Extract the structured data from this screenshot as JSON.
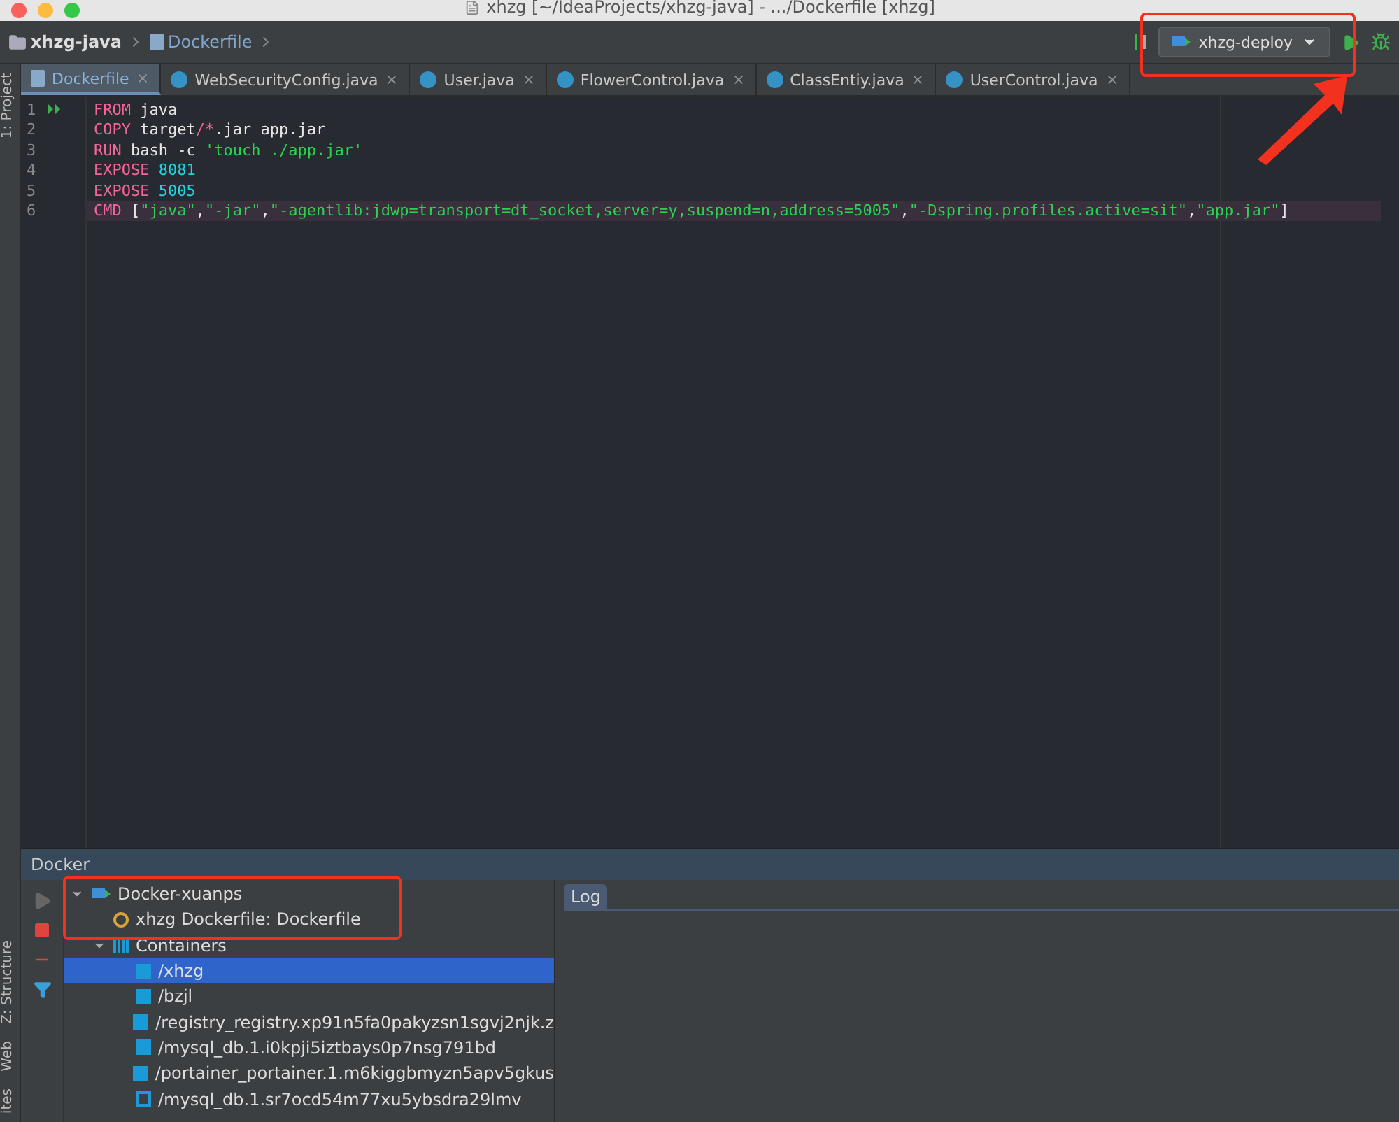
{
  "window": {
    "title": "xhzg [~/IdeaProjects/xhzg-java] - .../Dockerfile [xhzg]"
  },
  "breadcrumbs": [
    {
      "label": "xhzg-java",
      "kind": "project"
    },
    {
      "label": "Dockerfile",
      "kind": "file"
    }
  ],
  "run_config": {
    "label": "xhzg-deploy"
  },
  "side_tabs": [
    {
      "label": "1: Project",
      "kind": "top"
    },
    {
      "label": "Z: Structure",
      "kind": "bottom"
    },
    {
      "label": "Web",
      "kind": "bottom"
    },
    {
      "label": "ites",
      "kind": "bottom"
    }
  ],
  "tabs": [
    {
      "label": "Dockerfile",
      "kind": "docker",
      "selected": true
    },
    {
      "label": "WebSecurityConfig.java",
      "kind": "class",
      "selected": false
    },
    {
      "label": "User.java",
      "kind": "class",
      "selected": false
    },
    {
      "label": "FlowerControl.java",
      "kind": "class",
      "selected": false
    },
    {
      "label": "ClassEntiy.java",
      "kind": "class",
      "selected": false
    },
    {
      "label": "UserControl.java",
      "kind": "class",
      "selected": false
    }
  ],
  "code_lines": [
    {
      "number": "1",
      "current": false,
      "tokens": [
        {
          "kind": "keyword",
          "text": "FROM"
        },
        {
          "kind": "plain",
          "text": " java"
        }
      ]
    },
    {
      "number": "2",
      "current": false,
      "tokens": [
        {
          "kind": "keyword",
          "text": "COPY"
        },
        {
          "kind": "plain",
          "text": " target"
        },
        {
          "kind": "keyword",
          "text": "/*"
        },
        {
          "kind": "plain",
          "text": ".jar app.jar"
        }
      ]
    },
    {
      "number": "3",
      "current": false,
      "tokens": [
        {
          "kind": "keyword",
          "text": "RUN"
        },
        {
          "kind": "plain",
          "text": " bash -c "
        },
        {
          "kind": "string",
          "text": "'touch ./app.jar'"
        }
      ]
    },
    {
      "number": "4",
      "current": false,
      "tokens": [
        {
          "kind": "keyword",
          "text": "EXPOSE"
        },
        {
          "kind": "number",
          "text": " 8081"
        }
      ]
    },
    {
      "number": "5",
      "current": false,
      "tokens": [
        {
          "kind": "keyword",
          "text": "EXPOSE"
        },
        {
          "kind": "number",
          "text": " 5005"
        }
      ]
    },
    {
      "number": "6",
      "current": true,
      "tokens": [
        {
          "kind": "keyword",
          "text": "CMD"
        },
        {
          "kind": "plain",
          "text": " ["
        },
        {
          "kind": "string",
          "text": "\"java\""
        },
        {
          "kind": "plain",
          "text": ","
        },
        {
          "kind": "string",
          "text": "\"-jar\""
        },
        {
          "kind": "plain",
          "text": ","
        },
        {
          "kind": "string",
          "text": "\"-agentlib:jdwp=transport=dt_socket,server=y,suspend=n,address=5005\""
        },
        {
          "kind": "plain",
          "text": ","
        },
        {
          "kind": "string",
          "text": "\"-Dspring.profiles.active=sit\""
        },
        {
          "kind": "plain",
          "text": ","
        },
        {
          "kind": "string",
          "text": "\"app.jar\""
        },
        {
          "kind": "plain",
          "text": "]"
        }
      ]
    }
  ],
  "docker_panel": {
    "title": "Docker",
    "log_tab": {
      "label": "Log",
      "selected": true
    },
    "tree": [
      {
        "label": "Docker-xuanps",
        "kind": "server",
        "expanded": true,
        "selected": false,
        "children": [
          {
            "label": "xhzg Dockerfile: Dockerfile",
            "kind": "deployment",
            "selected": false
          },
          {
            "label": "Containers",
            "kind": "group",
            "expanded": true,
            "selected": false,
            "children": [
              {
                "label": "/xhzg",
                "kind": "running",
                "selected": true
              },
              {
                "label": "/bzjl",
                "kind": "running",
                "selected": false
              },
              {
                "label": "/registry_registry.xp91n5fa0pakyzsn1sgvj2njk.z",
                "kind": "running",
                "selected": false
              },
              {
                "label": "/mysql_db.1.i0kpji5iztbays0p7nsg791bd",
                "kind": "running",
                "selected": false
              },
              {
                "label": "/portainer_portainer.1.m6kiggbmyzn5apv5gkus",
                "kind": "running",
                "selected": false
              },
              {
                "label": "/mysql_db.1.sr7ocd54m77xu5ybsdra29lmv",
                "kind": "exited",
                "selected": false
              }
            ]
          }
        ]
      }
    ]
  }
}
